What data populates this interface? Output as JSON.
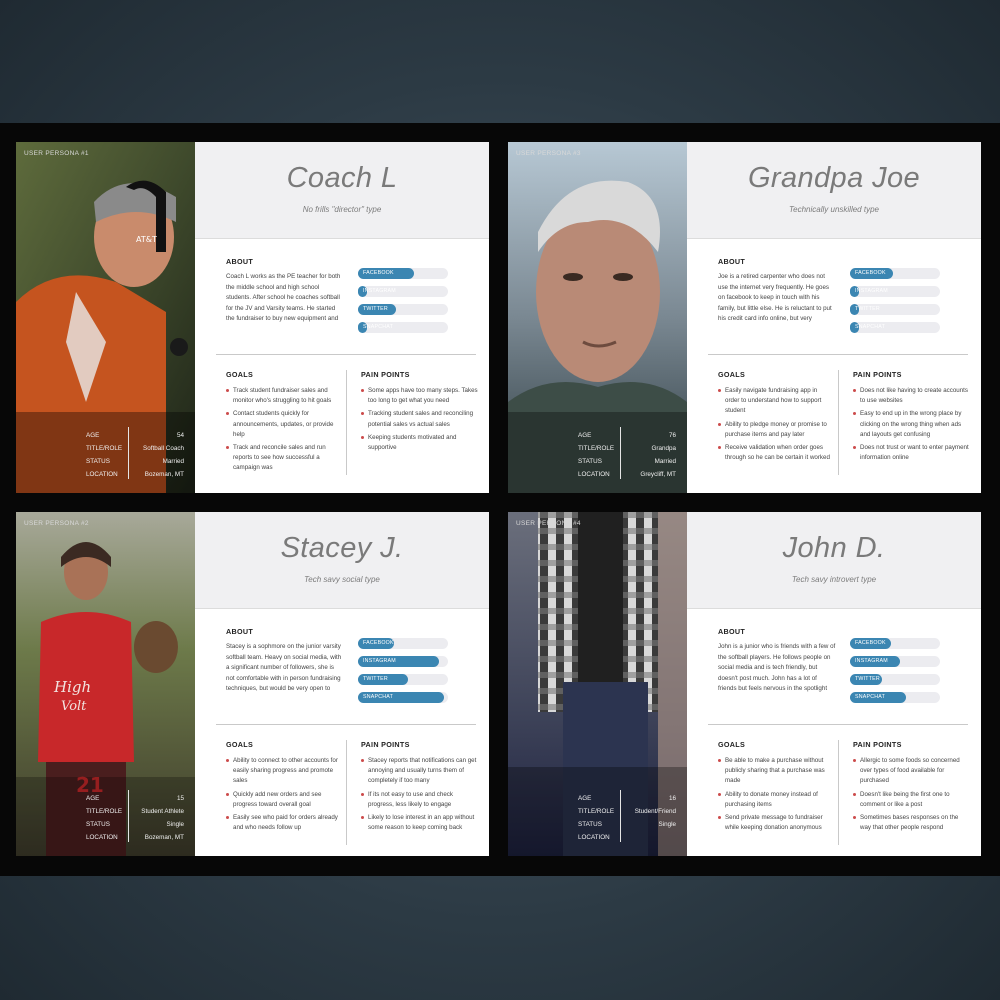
{
  "personas": [
    {
      "id": "coach",
      "label": "USER PERSONA #1",
      "name": "Coach L",
      "type": "No frills \"director\" type",
      "about_heading": "ABOUT",
      "about": "Coach L works as the PE teacher for both the middle school and high school students. After school he coaches softball for the JV and Varsity teams. He started the fundraiser to buy new equipment and to fund the",
      "social": [
        {
          "label": "FACEBOOK",
          "level": 0.62
        },
        {
          "label": "INSTAGRAM",
          "level": 0.1
        },
        {
          "label": "TWITTER",
          "level": 0.42
        },
        {
          "label": "SNAPCHAT",
          "level": 0.1
        }
      ],
      "goals_heading": "GOALS",
      "goals": [
        "Track student fundraiser sales and monitor who's struggling to hit goals",
        "Contact students quickly for announcements, updates, or provide help",
        "Track and reconcile sales and run reports to see how successful a campaign was"
      ],
      "pains_heading": "PAIN POINTS",
      "pains": [
        "Some apps have too many steps. Takes too long to get what you need",
        "Tracking student sales and reconciling potential sales vs actual sales",
        "Keeping students motivated and supportive"
      ],
      "stats": [
        {
          "k": "AGE",
          "v": "54"
        },
        {
          "k": "TITLE/ROLE",
          "v": "Softball Coach"
        },
        {
          "k": "STATUS",
          "v": "Married"
        },
        {
          "k": "LOCATION",
          "v": "Bozeman, MT"
        }
      ]
    },
    {
      "id": "grandpa",
      "label": "USER PERSONA #3",
      "name": "Grandpa Joe",
      "type": "Technically unskilled type",
      "about_heading": "ABOUT",
      "about": "Joe is a retired carpenter who does not use the internet very frequently. He goes on facebook to keep in touch with his family, but little else. He is reluctant to put his credit card info online, but very supportive of his grandchildren. Would likely pledge",
      "social": [
        {
          "label": "FACEBOOK",
          "level": 0.48
        },
        {
          "label": "INSTAGRAM",
          "level": 0.1
        },
        {
          "label": "TWITTER",
          "level": 0.1
        },
        {
          "label": "SNAPCHAT",
          "level": 0.1
        }
      ],
      "goals_heading": "GOALS",
      "goals": [
        "Easily navigate fundraising app in order to understand how to support student",
        "Ability to pledge money or promise to purchase items and pay later",
        "Receive validation when order goes through so he can be certain it worked"
      ],
      "pains_heading": "PAIN POINTS",
      "pains": [
        "Does not like having to create accounts to use websites",
        "Easy to end up in the wrong place by clicking on the wrong thing when ads and layouts get confusing",
        "Does not trust or want to enter payment information online"
      ],
      "stats": [
        {
          "k": "AGE",
          "v": "76"
        },
        {
          "k": "TITLE/ROLE",
          "v": "Grandpa"
        },
        {
          "k": "STATUS",
          "v": "Married"
        },
        {
          "k": "LOCATION",
          "v": "Greycliff, MT"
        }
      ]
    },
    {
      "id": "stacey",
      "label": "USER PERSONA #2",
      "name": "Stacey J.",
      "type": "Tech savy social type",
      "about_heading": "ABOUT",
      "about": "Stacey is a sophmore on the junior varsity softball team. Heavy on social media, with a significant number of followers, she is not comfortable with in person fundraising techniques, but would be very open to using her social media to promote goods and",
      "social": [
        {
          "label": "FACEBOOK",
          "level": 0.4
        },
        {
          "label": "INSTAGRAM",
          "level": 0.9
        },
        {
          "label": "TWITTER",
          "level": 0.56
        },
        {
          "label": "SNAPCHAT",
          "level": 0.95
        }
      ],
      "goals_heading": "GOALS",
      "goals": [
        "Ability to connect to other accounts for easily sharing progress and promote sales",
        "Quickly add new orders and see progress toward overall goal",
        "Easily see who paid for orders already and who needs follow up"
      ],
      "pains_heading": "PAIN POINTS",
      "pains": [
        "Stacey reports that notifications can get annoying and usually turns them of completely if too many",
        "If its not easy to use and check progress, less likely to engage",
        "Likely to lose interest in an app without some reason to keep coming back"
      ],
      "stats": [
        {
          "k": "AGE",
          "v": "15"
        },
        {
          "k": "TITLE/ROLE",
          "v": "Student Athlete"
        },
        {
          "k": "STATUS",
          "v": "Single"
        },
        {
          "k": "LOCATION",
          "v": "Bozeman, MT"
        }
      ]
    },
    {
      "id": "john",
      "label": "USER PERSONA #4",
      "name": "John D.",
      "type": "Tech savy introvert type",
      "about_heading": "ABOUT",
      "about": "John is a junior who is friends with a few of the softball players. He follows people on social media and is tech friendly, but doesn't post much. John has a lot of friends but feels nervous in the spotlight and doesn't like that some social media can be pushy.",
      "social": [
        {
          "label": "FACEBOOK",
          "level": 0.45
        },
        {
          "label": "INSTAGRAM",
          "level": 0.55
        },
        {
          "label": "TWITTER",
          "level": 0.35
        },
        {
          "label": "SNAPCHAT",
          "level": 0.62
        }
      ],
      "goals_heading": "GOALS",
      "goals": [
        "Be able to make a purchase without publicly sharing that a purchase was made",
        "Ability to donate money instead of purchasing items",
        "Send private message to fundraiser while keeping donation anonymous"
      ],
      "pains_heading": "PAIN POINTS",
      "pains": [
        "Allergic to some foods so concerned over types of food available for purchased",
        "Doesn't like being the first one to comment or like a post",
        "Sometimes bases responses on the way that other people respond"
      ],
      "stats": [
        {
          "k": "AGE",
          "v": "16"
        },
        {
          "k": "TITLE/ROLE",
          "v": "Student/Friend"
        },
        {
          "k": "STATUS",
          "v": "Single"
        },
        {
          "k": "LOCATION",
          "v": ""
        }
      ]
    }
  ],
  "colors": {
    "bar": "#3b86b2",
    "track": "#ececf0",
    "bullet": "#cc4b4b"
  }
}
